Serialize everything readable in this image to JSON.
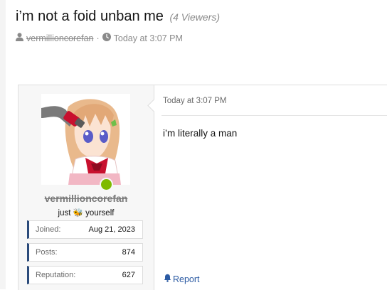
{
  "thread": {
    "title": "i’m not a foid unban me",
    "viewers": "(4 Viewers)",
    "author": "vermillioncorefan",
    "separator": "·",
    "timestamp": "Today at 3:07 PM"
  },
  "post": {
    "timestamp": "Today at 3:07 PM",
    "body": "i’m literally a man",
    "report_label": "Report",
    "user": {
      "username": "vermillioncorefan",
      "title_prefix": "just",
      "title_emoji": "🐝",
      "title_suffix": "yourself",
      "online": true,
      "stats": [
        {
          "label": "Joined:",
          "value": "Aug 21, 2023"
        },
        {
          "label": "Posts:",
          "value": "874"
        },
        {
          "label": "Reputation:",
          "value": "627"
        }
      ]
    }
  },
  "colors": {
    "accent_link": "#2b5aa3",
    "stat_accent": "#2a4a7a",
    "online": "#7fba00",
    "muted": "#8a8a8a"
  },
  "icons": [
    "user-icon",
    "clock-icon",
    "bell-icon"
  ]
}
